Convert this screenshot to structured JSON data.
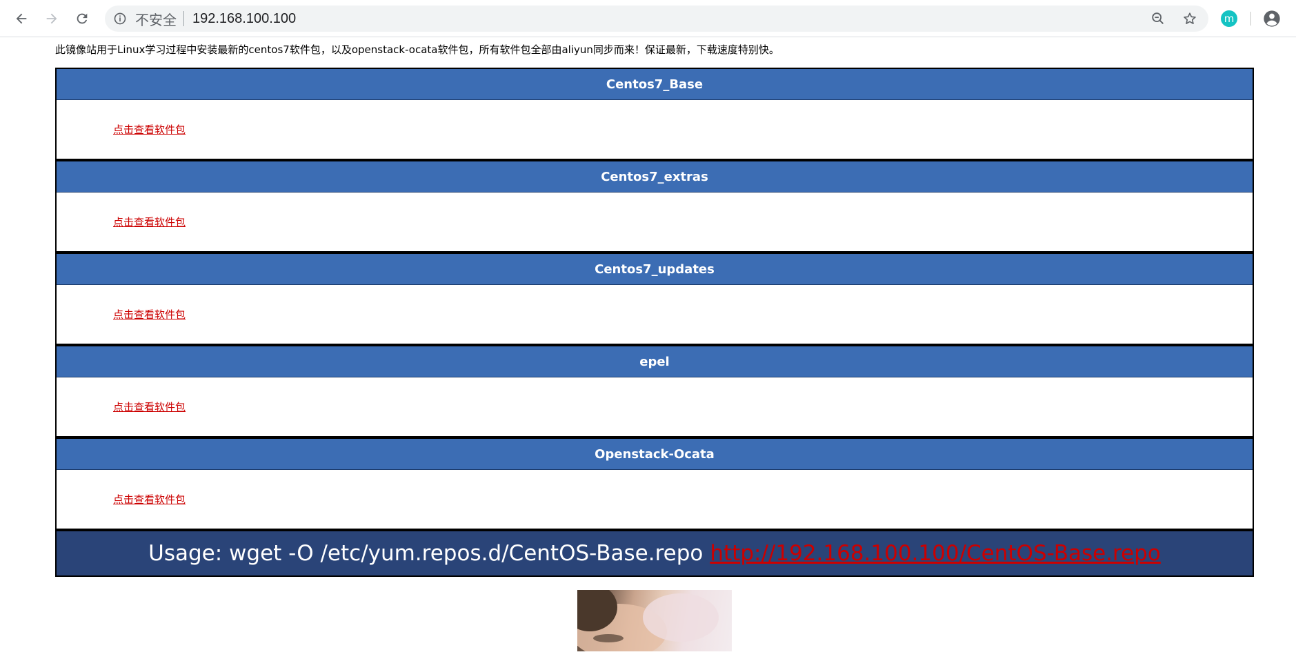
{
  "browser": {
    "back_icon": "arrow-left-icon",
    "forward_icon": "arrow-right-icon",
    "reload_icon": "reload-icon",
    "info_icon": "info-icon",
    "security_label": "不安全",
    "url": "192.168.100.100",
    "zoom_icon": "zoom-out-icon",
    "bookmark_icon": "star-icon",
    "extension_letter": "m",
    "account_icon": "account-icon"
  },
  "page": {
    "intro": "此镜像站用于Linux学习过程中安装最新的centos7软件包，以及openstack-ocata软件包，所有软件包全部由aliyun同步而来！保证最新，下载速度特别快。",
    "sections": [
      {
        "title": "Centos7_Base",
        "link": "点击查看软件包"
      },
      {
        "title": "Centos7_extras",
        "link": "点击查看软件包"
      },
      {
        "title": "Centos7_updates",
        "link": "点击查看软件包"
      },
      {
        "title": "epel",
        "link": "点击查看软件包"
      },
      {
        "title": "Openstack-Ocata",
        "link": "点击查看软件包"
      }
    ],
    "usage": {
      "label": "Usage: wget -O /etc/yum.repos.d/CentOS-Base.repo",
      "link": "http://192.168.100.100/CentOS-Base.repo"
    }
  },
  "colors": {
    "header_blue": "#3c6db4",
    "usage_navy": "#2a4478",
    "link_red": "#cc0000"
  }
}
